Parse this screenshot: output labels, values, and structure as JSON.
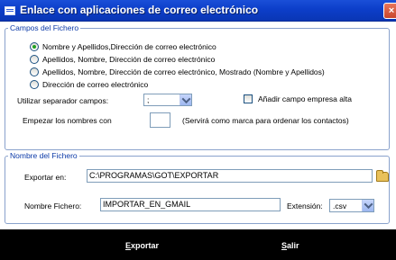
{
  "window": {
    "title": "Enlace con aplicaciones de correo electrónico",
    "close_glyph": "×"
  },
  "campos": {
    "legend": "Campos del Fichero",
    "options": [
      {
        "label": "Nombre y Apellidos,Dirección de correo electrónico",
        "selected": true
      },
      {
        "label": "Apellidos, Nombre, Dirección de correo electrónico",
        "selected": false
      },
      {
        "label": "Apellidos, Nombre, Dirección de correo electrónico, Mostrado (Nombre y Apellidos)",
        "selected": false
      },
      {
        "label": "Dirección de correo electrónico",
        "selected": false
      }
    ],
    "separator_label": "Utilizar separador campos:",
    "separator_value": ";",
    "empresa_label": "Añadir campo empresa alta",
    "empresa_checked": false,
    "start_label": "Empezar los nombres con",
    "start_value": "",
    "start_hint": "(Servirá como marca para ordenar los contactos)"
  },
  "nombre": {
    "legend": "Nombre del Fichero",
    "export_label": "Exportar en:",
    "export_path": "C:\\PROGRAMAS\\GOT\\EXPORTAR",
    "file_label": "Nombre Fichero:",
    "file_value": "IMPORTAR_EN_GMAIL",
    "ext_label": "Extensión:",
    "ext_value": ".csv"
  },
  "buttons": {
    "export_first": "E",
    "export_rest": "xportar",
    "exit_first": "S",
    "exit_rest": "alir"
  },
  "icons": {
    "title": "window-icon",
    "folder": "folder-open-icon",
    "dropdown": "chevron-down-icon"
  }
}
